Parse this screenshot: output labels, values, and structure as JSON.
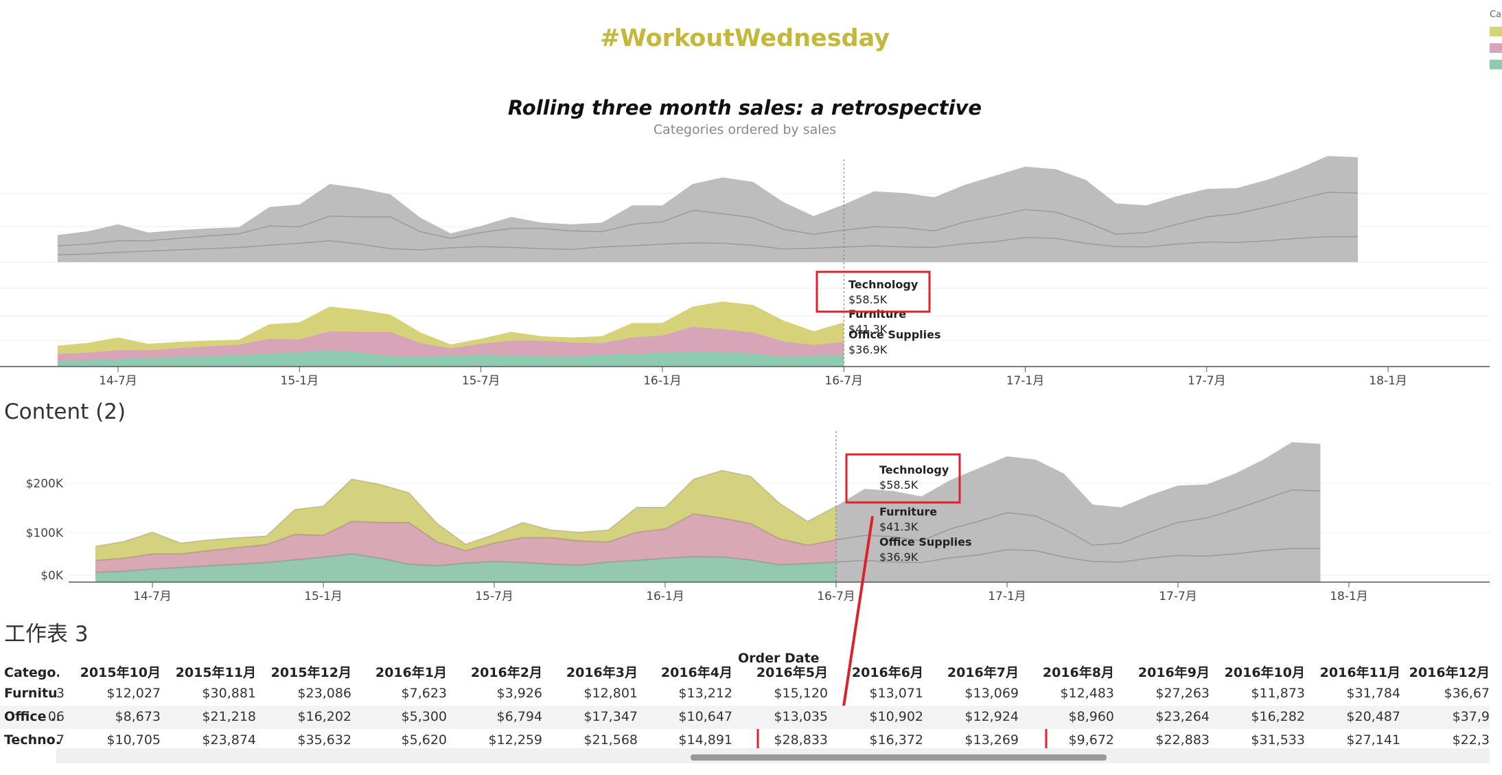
{
  "header": {
    "title": "#WorkoutWednesday",
    "chart_title": "Rolling three month sales: a retrospective",
    "chart_subtitle": "Categories ordered by sales",
    "legend_clip": "Ca"
  },
  "colors": {
    "title": "#c3b83a",
    "technology": "#d6d27a",
    "furniture": "#d8a4b8",
    "office_supplies": "#8ecbb0",
    "grey": "#bdbdbd",
    "highlight": "#e0202a"
  },
  "x_axis_labels": [
    "14-7月",
    "15-1月",
    "15-7月",
    "16-1月",
    "16-7月",
    "17-1月",
    "17-7月",
    "18-1月"
  ],
  "annotations": {
    "technology": {
      "name": "Technology",
      "value": "$58.5K"
    },
    "furniture": {
      "name": "Furniture",
      "value": "$41.3K"
    },
    "office_supplies": {
      "name": "Office Supplies",
      "value": "$36.9K"
    }
  },
  "section2_title": "Content (2)",
  "section3_title": "工作表 3",
  "chart_data": [
    {
      "type": "area",
      "title": "Rolling three month sales: a retrospective",
      "subtitle": "Categories ordered by sales",
      "x_ticks": [
        "14-7月",
        "15-1月",
        "15-7月",
        "16-1月",
        "16-7月",
        "17-1月",
        "17-7月",
        "18-1月"
      ],
      "stacked": true,
      "cutoff": "16-7月",
      "x": [
        -2,
        -1,
        0,
        1,
        2,
        3,
        4,
        5,
        6,
        7,
        8,
        9,
        10,
        11,
        12,
        13,
        14,
        15,
        16,
        17,
        18,
        19,
        20,
        21,
        22,
        23,
        24,
        25,
        26,
        27,
        28,
        29,
        30,
        31,
        32,
        33,
        34,
        35,
        36,
        37,
        38,
        39,
        40,
        41
      ],
      "series": [
        {
          "name": "Office Supplies",
          "values": [
            18,
            20,
            24,
            27,
            30,
            33,
            36,
            41,
            46,
            52,
            44,
            33,
            30,
            35,
            38,
            36,
            33,
            31,
            37,
            40,
            44,
            47,
            46,
            41,
            32,
            34,
            37,
            40,
            37,
            36,
            45,
            50,
            60,
            58,
            46,
            38,
            37,
            44,
            49,
            48,
            52,
            58,
            62,
            62
          ]
        },
        {
          "name": "Furniture",
          "values": [
            40,
            44,
            52,
            52,
            58,
            64,
            69,
            88,
            86,
            112,
            110,
            110,
            74,
            58,
            72,
            82,
            82,
            76,
            74,
            92,
            98,
            126,
            118,
            108,
            80,
            68,
            78,
            86,
            84,
            76,
            98,
            112,
            128,
            122,
            98,
            68,
            72,
            92,
            110,
            118,
            134,
            152,
            170,
            168
          ]
        },
        {
          "name": "Technology",
          "values": [
            66,
            75,
            92,
            72,
            78,
            82,
            85,
            134,
            140,
            190,
            180,
            165,
            108,
            70,
            88,
            110,
            96,
            92,
            96,
            138,
            138,
            190,
            206,
            195,
            146,
            112,
            140,
            172,
            168,
            158,
            188,
            210,
            232,
            226,
            200,
            143,
            138,
            160,
            178,
            180,
            200,
            226,
            258,
            255
          ]
        }
      ]
    },
    {
      "type": "area",
      "title": "",
      "subtitle": "",
      "x_ticks": [
        "14-7月",
        "15-1月",
        "15-7月",
        "16-1月",
        "16-7月",
        "17-1月",
        "17-7月",
        "18-1月"
      ],
      "ylabel": "",
      "y_ticks": [
        "$0K",
        "$100K",
        "$200K"
      ],
      "ylim": [
        0,
        290
      ],
      "stacked": true,
      "cutoff": "16-7月",
      "x": [
        -2,
        -1,
        0,
        1,
        2,
        3,
        4,
        5,
        6,
        7,
        8,
        9,
        10,
        11,
        12,
        13,
        14,
        15,
        16,
        17,
        18,
        19,
        20,
        21,
        22,
        23,
        24,
        25,
        26,
        27,
        28,
        29,
        30,
        31,
        32,
        33,
        34,
        35,
        36,
        37,
        38,
        39,
        40,
        41
      ],
      "series": [
        {
          "name": "Office Supplies",
          "values": [
            18,
            20,
            24,
            27,
            30,
            33,
            36,
            41,
            46,
            52,
            44,
            33,
            30,
            35,
            38,
            36,
            33,
            31,
            37,
            40,
            44,
            47,
            46,
            41,
            32,
            34,
            37,
            40,
            37,
            36,
            45,
            50,
            60,
            58,
            46,
            38,
            37,
            44,
            49,
            48,
            52,
            58,
            62,
            62
          ]
        },
        {
          "name": "Furniture",
          "values": [
            40,
            44,
            52,
            52,
            58,
            64,
            69,
            88,
            86,
            112,
            110,
            110,
            74,
            58,
            72,
            82,
            82,
            76,
            74,
            92,
            98,
            126,
            118,
            108,
            80,
            68,
            78,
            86,
            84,
            76,
            98,
            112,
            128,
            122,
            98,
            68,
            72,
            92,
            110,
            118,
            134,
            152,
            170,
            168
          ]
        },
        {
          "name": "Technology",
          "values": [
            66,
            75,
            92,
            72,
            78,
            82,
            85,
            134,
            140,
            190,
            180,
            165,
            108,
            70,
            88,
            110,
            96,
            92,
            96,
            138,
            138,
            190,
            206,
            195,
            146,
            112,
            140,
            172,
            168,
            158,
            188,
            210,
            232,
            226,
            200,
            143,
            138,
            160,
            178,
            180,
            200,
            226,
            258,
            255
          ]
        }
      ]
    },
    {
      "type": "table",
      "title": "Order Date",
      "row_header": "Catego..",
      "columns": [
        "2015年10月",
        "2015年11月",
        "2015年12月",
        "2016年1月",
        "2016年2月",
        "2016年3月",
        "2016年4月",
        "2016年5月",
        "2016年6月",
        "2016年7月",
        "2016年8月",
        "2016年9月",
        "2016年10月",
        "2016年11月",
        "2016年12月"
      ],
      "rows": [
        {
          "category": "Furnitu..",
          "prev": "3",
          "values": [
            "$12,027",
            "$30,881",
            "$23,086",
            "$7,623",
            "$3,926",
            "$12,801",
            "$13,212",
            "$15,120",
            "$13,071",
            "$13,069",
            "$12,483",
            "$27,263",
            "$11,873",
            "$31,784",
            "$36,67"
          ]
        },
        {
          "category": "Office ..",
          "prev": "06",
          "values": [
            "$8,673",
            "$21,218",
            "$16,202",
            "$5,300",
            "$6,794",
            "$17,347",
            "$10,647",
            "$13,035",
            "$10,902",
            "$12,924",
            "$8,960",
            "$23,264",
            "$16,282",
            "$20,487",
            "$37,9"
          ]
        },
        {
          "category": "Techno..",
          "prev": "7",
          "values": [
            "$10,705",
            "$23,874",
            "$35,632",
            "$5,620",
            "$12,259",
            "$21,568",
            "$14,891",
            "$28,833",
            "$16,372",
            "$13,269",
            "$9,672",
            "$22,883",
            "$31,533",
            "$27,141",
            "$22,3"
          ]
        }
      ],
      "prev_col_suffix": "月"
    }
  ]
}
